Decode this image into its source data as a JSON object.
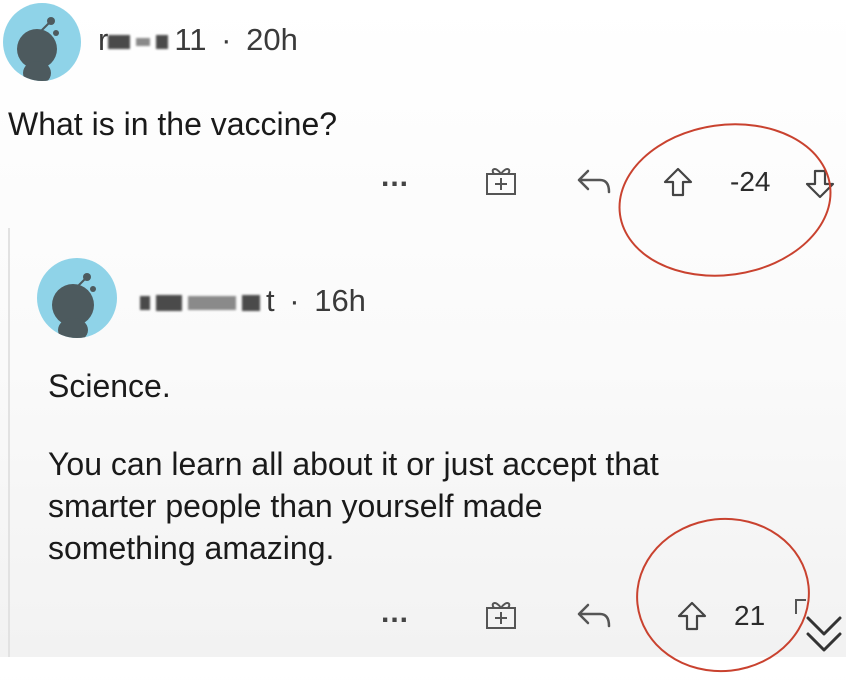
{
  "post": {
    "username_tail": "11",
    "time": "20h",
    "separator": "·",
    "text": "What is in the vaccine?",
    "more": "...",
    "score": "-24"
  },
  "reply": {
    "username_tail": "t",
    "time": "16h",
    "separator": "·",
    "text_line1": "Science.",
    "text_body": "You can learn all about it or just accept that\nsmarter people than yourself made\nsomething amazing.",
    "more": "...",
    "score": "21"
  },
  "colors": {
    "highlight": "#c9422f",
    "avatar_bg": "#8fd3e8"
  }
}
